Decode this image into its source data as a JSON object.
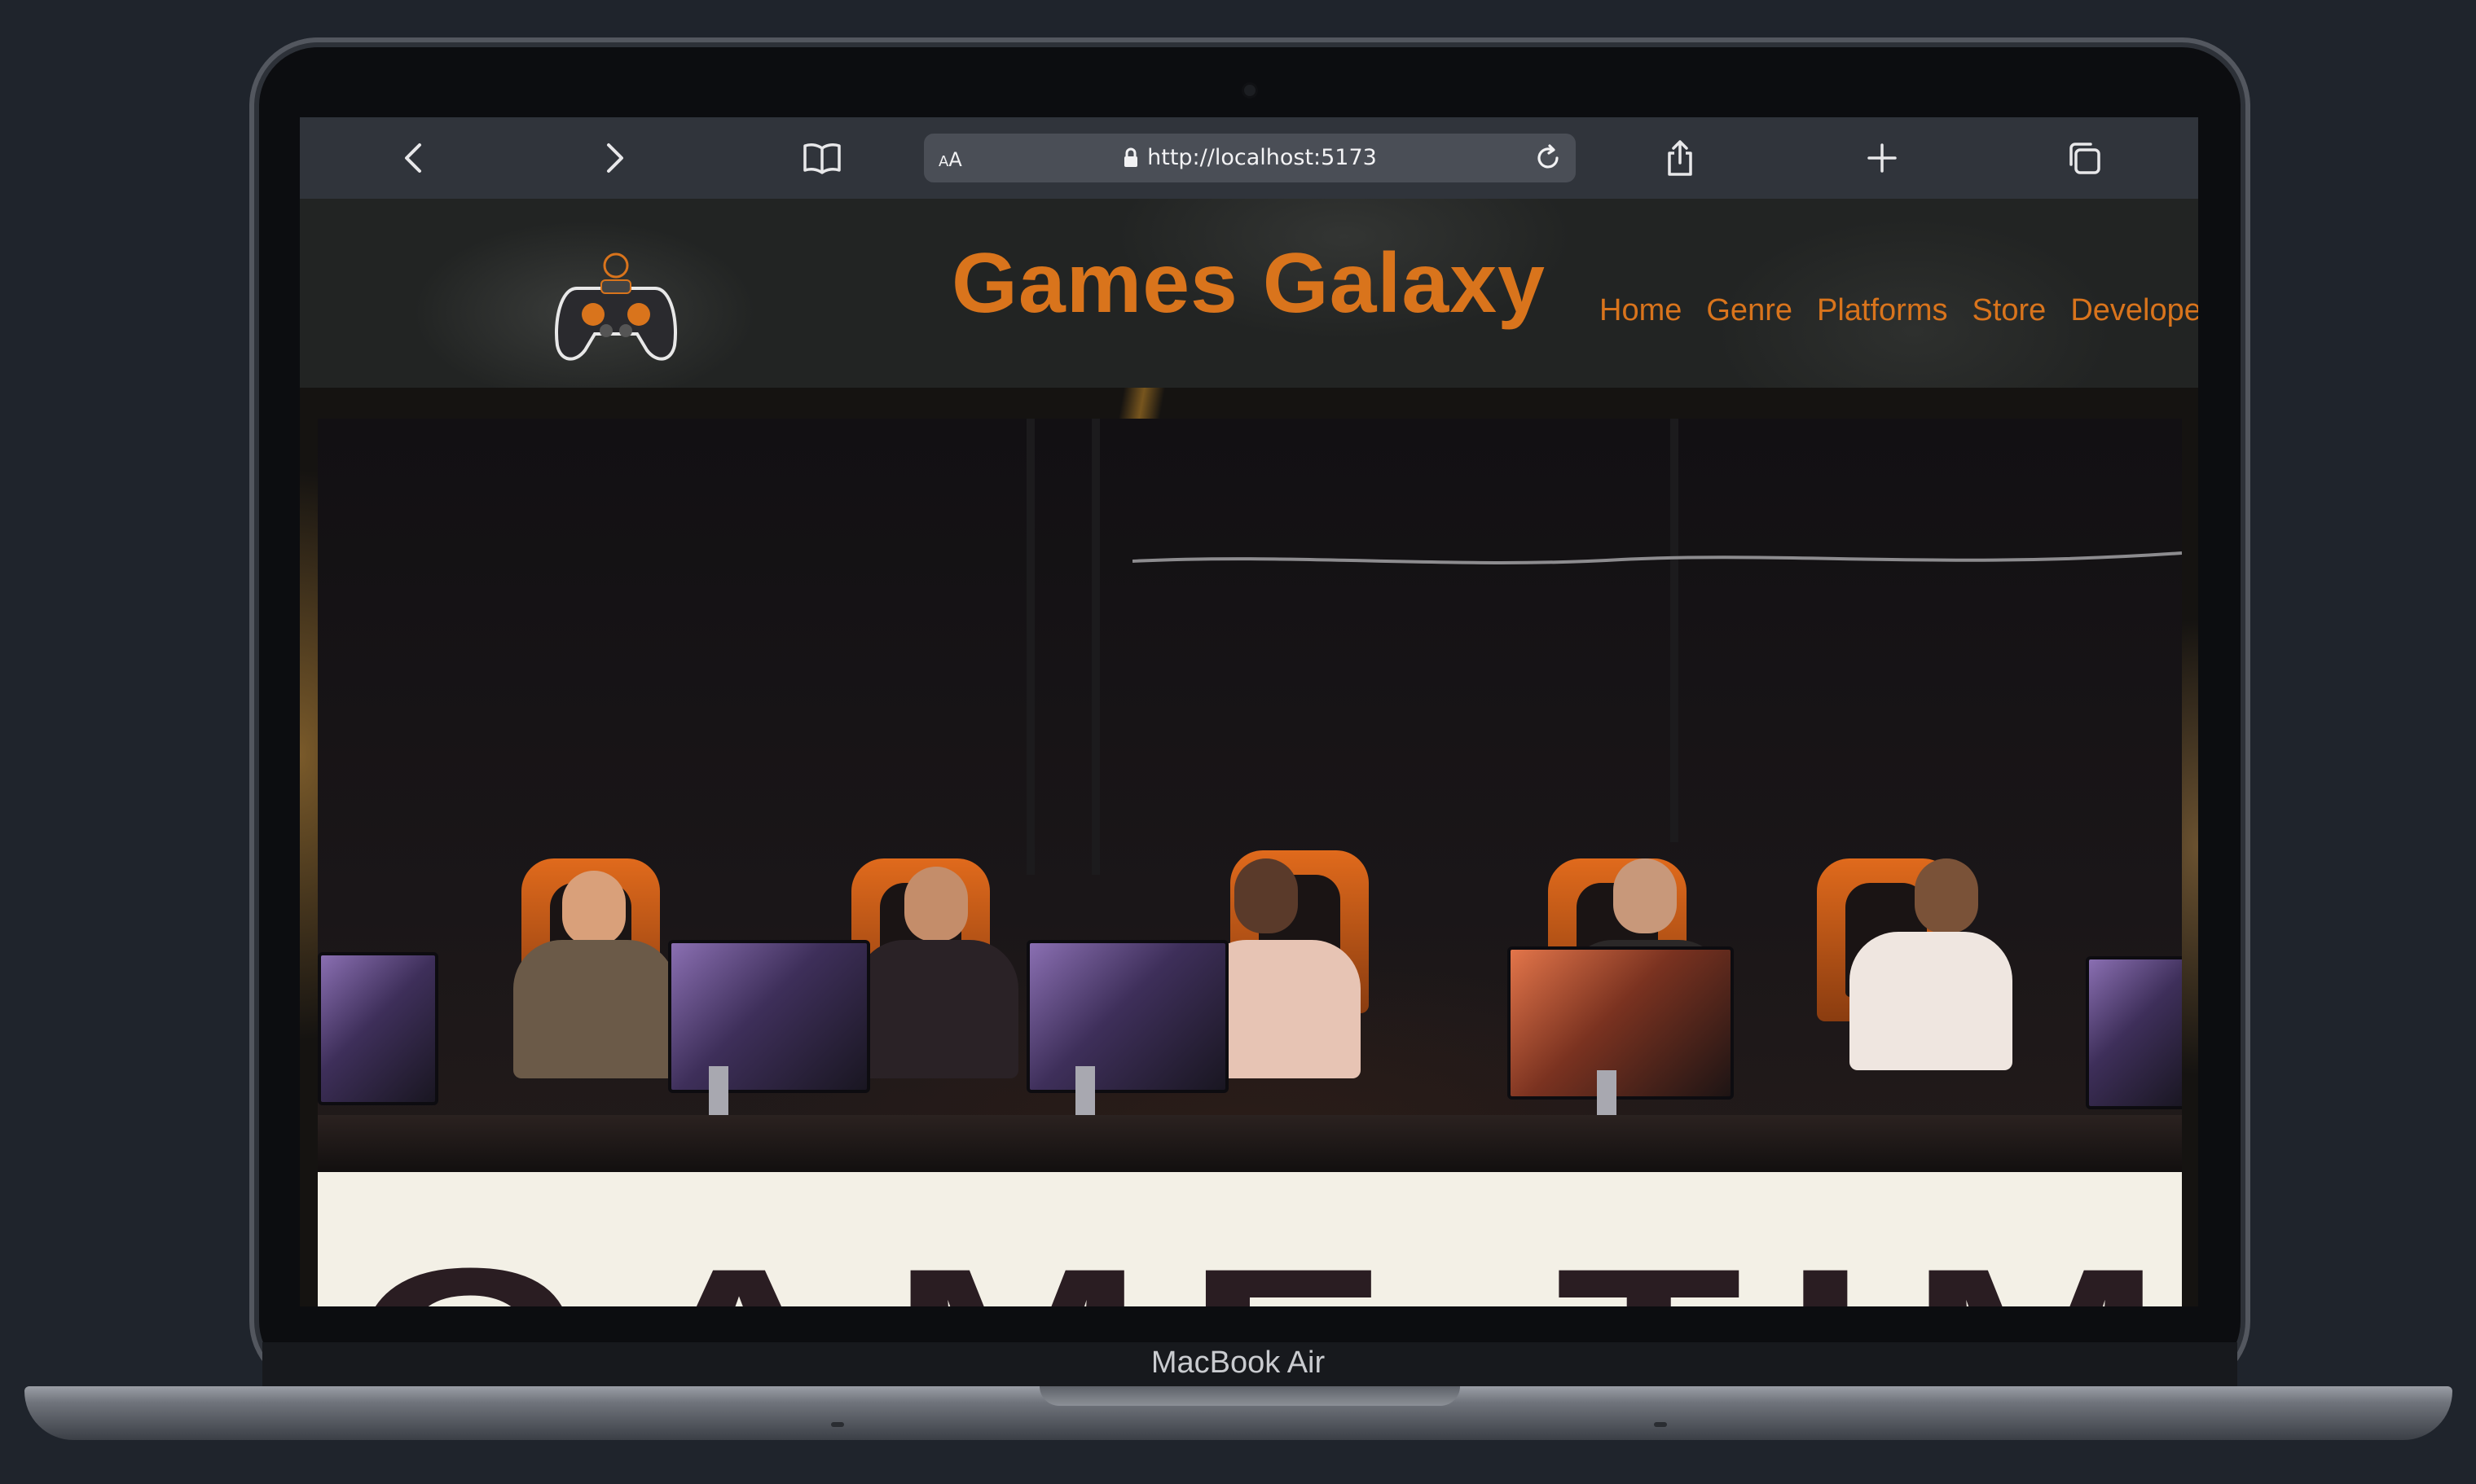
{
  "device": {
    "label": "MacBook Air"
  },
  "browser": {
    "text_size_button": {
      "big": "A",
      "small": "A"
    },
    "url": "http://localhost:5173"
  },
  "site": {
    "brand": "Games Galaxy",
    "nav": [
      "Home",
      "Genre",
      "Platforms",
      "Store",
      "Developer"
    ],
    "accent": "#d9741c"
  },
  "hero": {
    "banner_text": "GAME TIME"
  }
}
